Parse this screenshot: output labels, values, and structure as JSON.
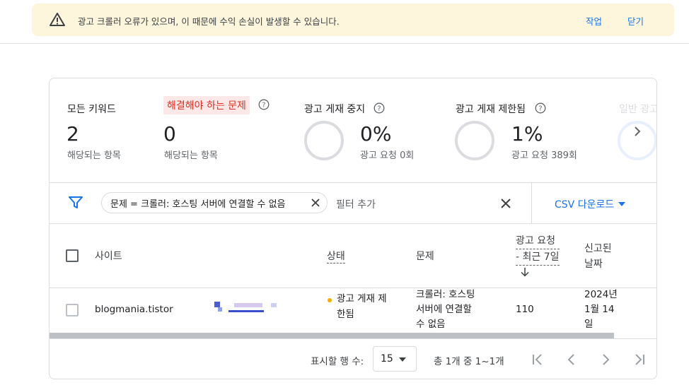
{
  "banner": {
    "message": "광고 크롤러 오류가 있으며, 이 때문에 수익 손실이 발생할 수 있습니다.",
    "action_label": "작업",
    "close_label": "닫기"
  },
  "summary": {
    "all_keywords": {
      "label": "모든 키워드",
      "value": "2",
      "sub": "해당되는 항목"
    },
    "issues_to_fix": {
      "label": "해결해야 하는 문제",
      "value": "0",
      "sub": "해당되는 항목"
    },
    "ad_serving_stopped": {
      "label": "광고 게재 중지",
      "value": "0%",
      "sub": "광고 요청 0회",
      "fraction": 0.0
    },
    "ad_serving_limited": {
      "label": "광고 게재 제한됨",
      "value": "1%",
      "sub": "광고 요청 389회",
      "fraction": 0.01
    },
    "general_ads": {
      "label": "일반 광고"
    }
  },
  "filter": {
    "chip_label": "문제 = 크롤러: 호스팅 서버에 연결할 수 없음",
    "add_filter_label": "필터 추가",
    "csv_label": "CSV 다운로드"
  },
  "table": {
    "headers": {
      "site": "사이트",
      "status": "상태",
      "issue": "문제",
      "requests_line1": "광고 요청",
      "requests_line2": "- 최근 7일",
      "reported_line1": "신고된",
      "reported_line2": "날짜"
    },
    "rows": [
      {
        "site": "blogmania.tistor",
        "status_line1": "광고 게재 제",
        "status_line2": "한됨",
        "issue_line1": "크롤러: 호스팅",
        "issue_line2": "서버에 연결할",
        "issue_line3": "수 없음",
        "requests": "110",
        "reported_line1": "2024년",
        "reported_line2": "1월 14",
        "reported_line3": "일"
      }
    ]
  },
  "pagination": {
    "rows_per_page_label": "표시할 행 수:",
    "rows_per_page_value": "15",
    "range_label": "총 1개 중 1~1개"
  },
  "colors": {
    "accent": "#1a73e8",
    "warning_bg": "#fdf5dc",
    "issue_tag_bg": "#fce8e6",
    "issue_tag_text": "#d93025",
    "status_dot": "#f9ab00"
  }
}
